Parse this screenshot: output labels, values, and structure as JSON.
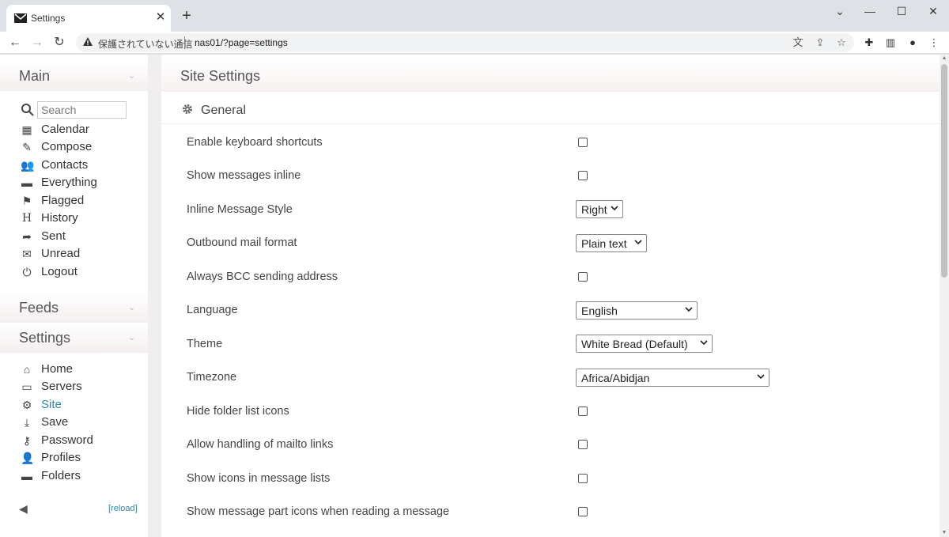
{
  "browser": {
    "tab_title": "Settings",
    "security_text": "保護されていない通信",
    "url": "nas01/?page=settings"
  },
  "sidebar": {
    "main_title": "Main",
    "search_placeholder": "Search",
    "main_items": [
      {
        "label": "Calendar",
        "icon": "calendar-icon"
      },
      {
        "label": "Compose",
        "icon": "compose-icon"
      },
      {
        "label": "Contacts",
        "icon": "contacts-icon"
      },
      {
        "label": "Everything",
        "icon": "folder-icon"
      },
      {
        "label": "Flagged",
        "icon": "flag-icon"
      },
      {
        "label": "History",
        "icon": "history-icon"
      },
      {
        "label": "Sent",
        "icon": "sent-icon"
      },
      {
        "label": "Unread",
        "icon": "envelope-icon"
      },
      {
        "label": "Logout",
        "icon": "power-icon"
      }
    ],
    "feeds_title": "Feeds",
    "settings_title": "Settings",
    "settings_items": [
      {
        "label": "Home",
        "icon": "home-icon"
      },
      {
        "label": "Servers",
        "icon": "monitor-icon"
      },
      {
        "label": "Site",
        "icon": "gear-icon",
        "active": true
      },
      {
        "label": "Save",
        "icon": "download-icon"
      },
      {
        "label": "Password",
        "icon": "key-icon"
      },
      {
        "label": "Profiles",
        "icon": "person-icon"
      },
      {
        "label": "Folders",
        "icon": "folder-icon"
      }
    ],
    "reload_label": "[reload]",
    "accent_color": "#2b8ca8"
  },
  "main": {
    "title": "Site Settings",
    "group_title": "General",
    "settings": [
      {
        "label": "Enable keyboard shortcuts",
        "type": "checkbox",
        "checked": false
      },
      {
        "label": "Show messages inline",
        "type": "checkbox",
        "checked": false
      },
      {
        "label": "Inline Message Style",
        "type": "select",
        "value": "Right"
      },
      {
        "label": "Outbound mail format",
        "type": "select",
        "value": "Plain text"
      },
      {
        "label": "Always BCC sending address",
        "type": "checkbox",
        "checked": false
      },
      {
        "label": "Language",
        "type": "select",
        "value": "English"
      },
      {
        "label": "Theme",
        "type": "select",
        "value": "White Bread (Default)"
      },
      {
        "label": "Timezone",
        "type": "select",
        "value": "Africa/Abidjan"
      },
      {
        "label": "Hide folder list icons",
        "type": "checkbox",
        "checked": false
      },
      {
        "label": "Allow handling of mailto links",
        "type": "checkbox",
        "checked": false
      },
      {
        "label": "Show icons in message lists",
        "type": "checkbox",
        "checked": false
      },
      {
        "label": "Show message part icons when reading a message",
        "type": "checkbox",
        "checked": false
      }
    ]
  }
}
